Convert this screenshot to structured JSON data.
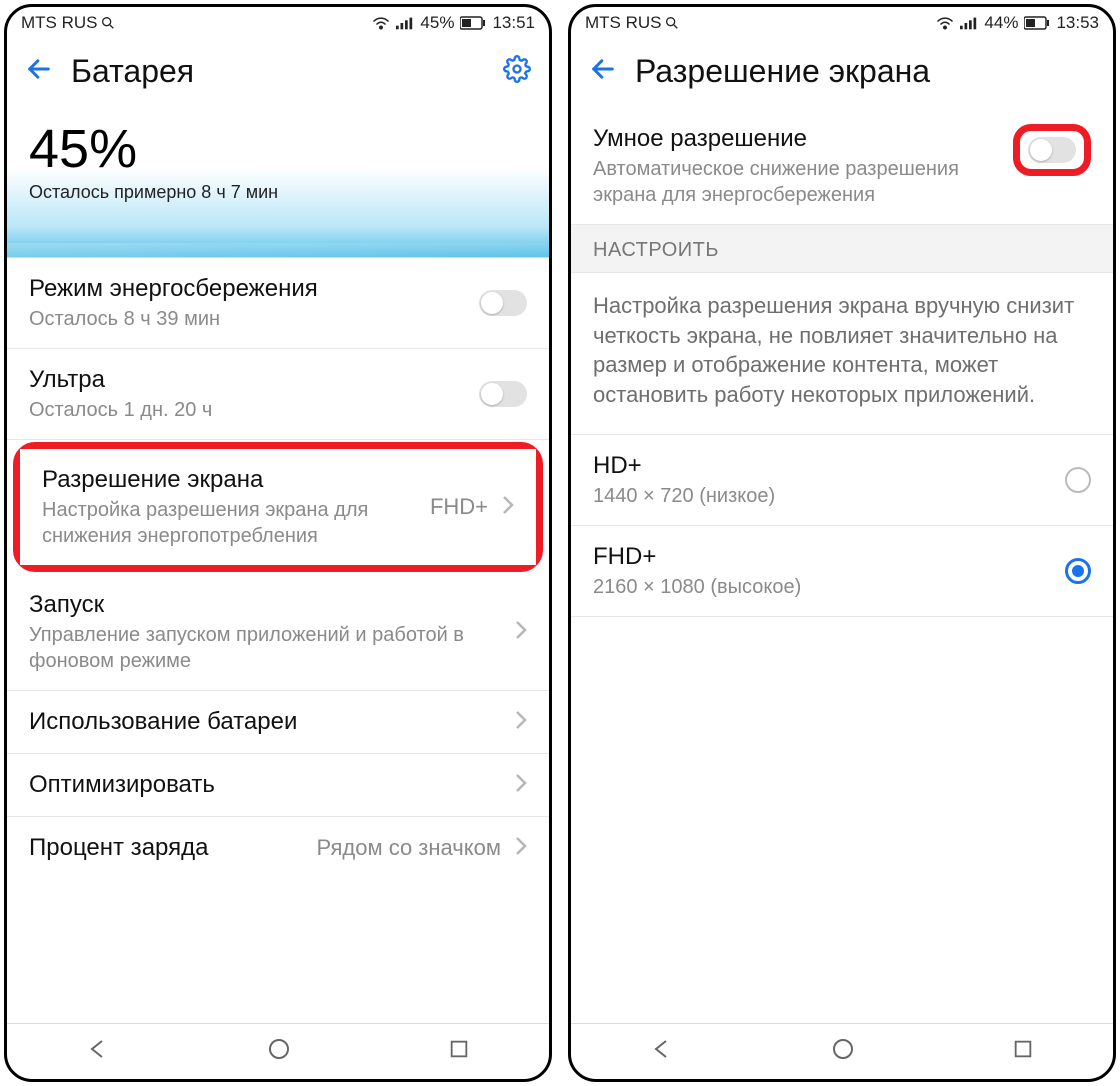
{
  "left": {
    "status": {
      "carrier": "MTS RUS",
      "battery_pct": "45%",
      "time": "13:51"
    },
    "header": {
      "title": "Батарея"
    },
    "hero": {
      "pct": "45%",
      "remaining": "Осталось примерно 8 ч 7 мин"
    },
    "rows": {
      "power_save": {
        "title": "Режим энергосбережения",
        "sub": "Осталось 8 ч 39 мин"
      },
      "ultra": {
        "title": "Ультра",
        "sub": "Осталось 1 дн. 20 ч"
      },
      "resolution": {
        "title": "Разрешение экрана",
        "sub": "Настройка разрешения экрана для снижения энергопотребления",
        "value": "FHD+"
      },
      "launch": {
        "title": "Запуск",
        "sub": "Управление запуском приложений и работой в фоновом режиме"
      },
      "usage": {
        "title": "Использование батареи"
      },
      "optimize": {
        "title": "Оптимизировать"
      },
      "percent": {
        "title": "Процент заряда",
        "value": "Рядом со значком"
      }
    }
  },
  "right": {
    "status": {
      "carrier": "MTS RUS",
      "battery_pct": "44%",
      "time": "13:53"
    },
    "header": {
      "title": "Разрешение экрана"
    },
    "smart": {
      "title": "Умное разрешение",
      "sub": "Автоматическое снижение разрешения экрана для энергосбережения"
    },
    "section": "НАСТРОИТЬ",
    "info": "Настройка разрешения экрана вручную снизит четкость экрана, не повлияет значительно на размер и отображение контента, может остановить работу некоторых приложений.",
    "options": {
      "hd": {
        "title": "HD+",
        "sub": "1440 × 720 (низкое)"
      },
      "fhd": {
        "title": "FHD+",
        "sub": "2160 × 1080 (высокое)"
      }
    }
  }
}
